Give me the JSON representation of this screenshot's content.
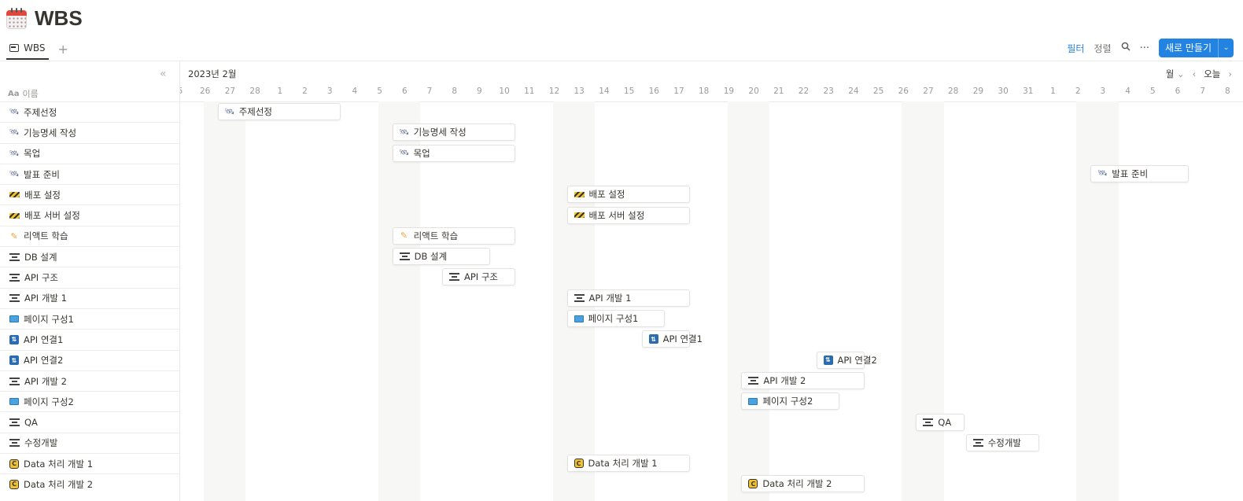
{
  "page": {
    "title": "WBS"
  },
  "views": {
    "tab_label": "WBS",
    "add": "+"
  },
  "toolbar": {
    "filter": "필터",
    "sort": "정렬",
    "search_icon": "search-icon",
    "more": "···",
    "new_label": "새로 만들기",
    "new_arrow": "⌄"
  },
  "list": {
    "collapse": "«",
    "name_header_aa": "Aa",
    "name_header": "이름"
  },
  "timeline": {
    "month_label": "2023년 2월",
    "scale": "월",
    "today": "오늘",
    "prev": "‹",
    "next": "›",
    "days": [
      "5",
      "26",
      "27",
      "28",
      "1",
      "2",
      "3",
      "4",
      "5",
      "6",
      "7",
      "8",
      "9",
      "10",
      "11",
      "12",
      "13",
      "14",
      "15",
      "16",
      "17",
      "18",
      "19",
      "20",
      "21",
      "22",
      "23",
      "24",
      "25",
      "26",
      "27",
      "28",
      "29",
      "30",
      "31",
      "1",
      "2",
      "3",
      "4",
      "5",
      "6",
      "7",
      "8"
    ]
  },
  "colors": {
    "accent": "#2383e2",
    "weekend": "#f7f7f5",
    "border": "#e9e9e7",
    "text": "#37352f"
  },
  "tasks": [
    {
      "name": "주제선정",
      "icon": "satellite-icon",
      "start": 1,
      "span": 5
    },
    {
      "name": "기능명세 작성",
      "icon": "satellite-icon",
      "start": 8,
      "span": 5
    },
    {
      "name": "목업",
      "icon": "satellite-icon",
      "start": 8,
      "span": 5
    },
    {
      "name": "발표 준비",
      "icon": "satellite-icon",
      "start": 36,
      "span": 4
    },
    {
      "name": "배포 설정",
      "icon": "barrier-icon",
      "start": 15,
      "span": 5
    },
    {
      "name": "배포 서버 설정",
      "icon": "barrier-icon",
      "start": 15,
      "span": 5
    },
    {
      "name": "리액트 학습",
      "icon": "pencil-icon",
      "start": 8,
      "span": 5
    },
    {
      "name": "DB 설계",
      "icon": "railway-icon",
      "start": 8,
      "span": 4
    },
    {
      "name": "API 구조",
      "icon": "railway-icon",
      "start": 10,
      "span": 3
    },
    {
      "name": "API 개발 1",
      "icon": "railway-icon",
      "start": 15,
      "span": 5
    },
    {
      "name": "페이지 구성1",
      "icon": "computer-icon",
      "start": 15,
      "span": 4
    },
    {
      "name": "API 연결1",
      "icon": "sync-icon",
      "start": 18,
      "span": 2
    },
    {
      "name": "API 연결2",
      "icon": "sync-icon",
      "start": 25,
      "span": 2
    },
    {
      "name": "API 개발 2",
      "icon": "railway-icon",
      "start": 22,
      "span": 5
    },
    {
      "name": "페이지 구성2",
      "icon": "computer-icon",
      "start": 22,
      "span": 4
    },
    {
      "name": "QA",
      "icon": "railway-icon",
      "start": 29,
      "span": 2
    },
    {
      "name": "수정개발",
      "icon": "railway-icon",
      "start": 31,
      "span": 3
    },
    {
      "name": "Data 처리 개발 1",
      "icon": "copyright-icon",
      "start": 15,
      "span": 5
    },
    {
      "name": "Data 처리 개발 2",
      "icon": "copyright-icon",
      "start": 22,
      "span": 5
    }
  ]
}
